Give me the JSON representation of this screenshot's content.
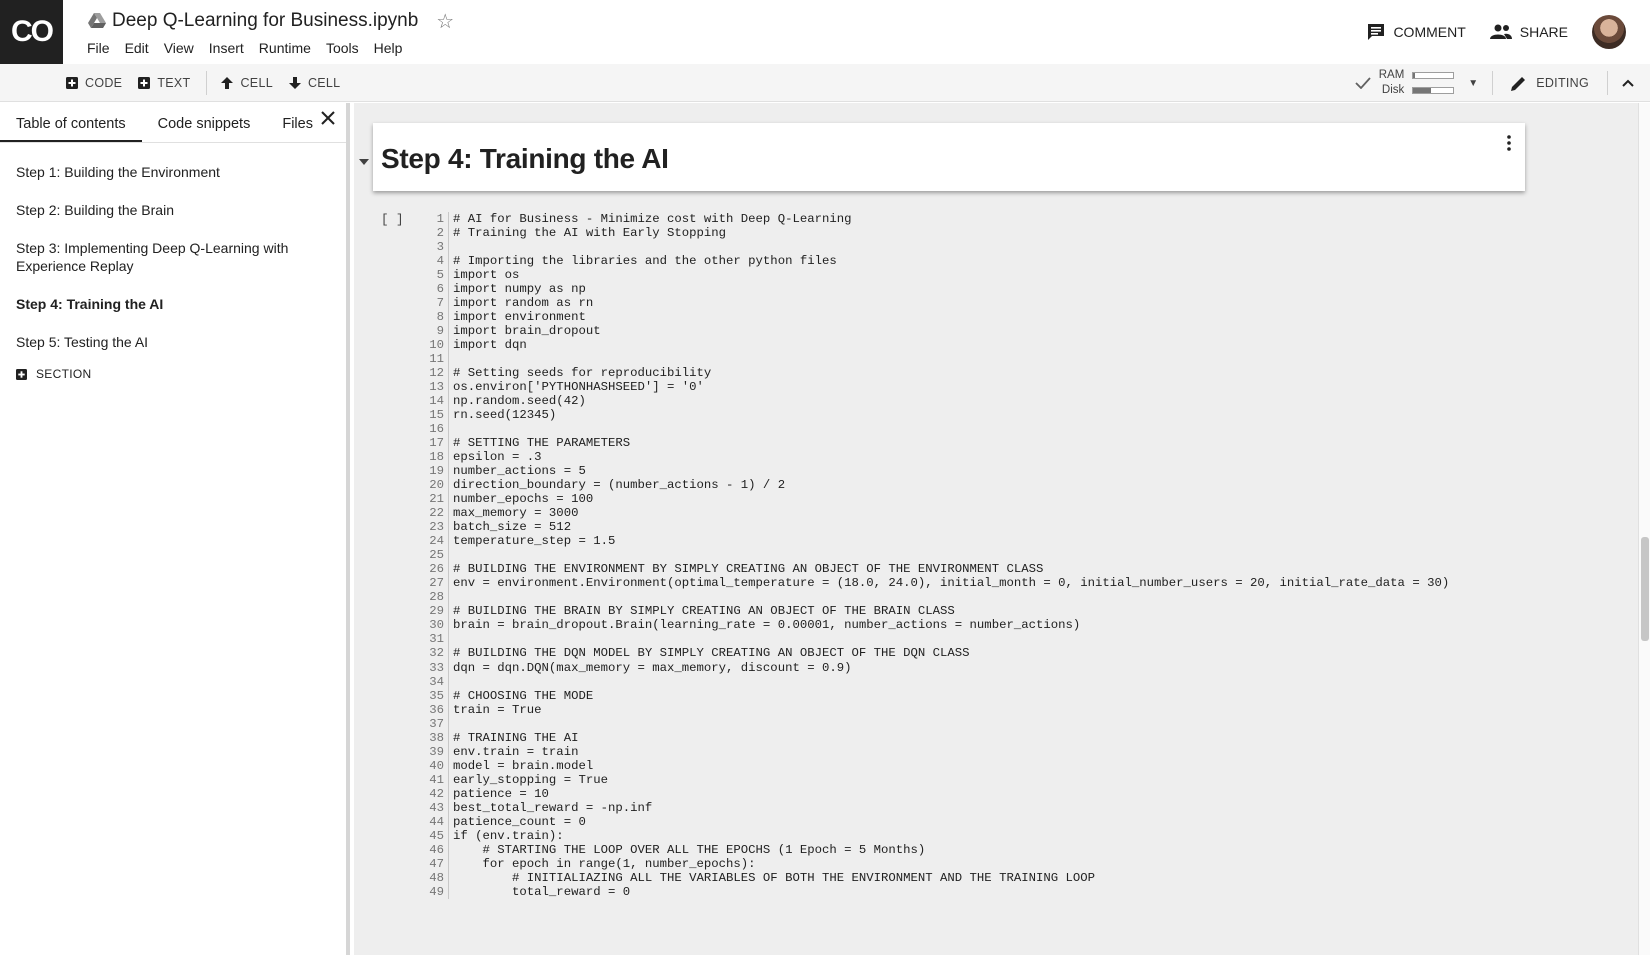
{
  "app": {
    "logo": "CO",
    "doc_title": "Deep Q-Learning for Business.ipynb"
  },
  "menu": [
    "File",
    "Edit",
    "View",
    "Insert",
    "Runtime",
    "Tools",
    "Help"
  ],
  "header_actions": {
    "comment": "COMMENT",
    "share": "SHARE"
  },
  "toolbar": {
    "add_code": "CODE",
    "add_text": "TEXT",
    "cell_up": "CELL",
    "cell_down": "CELL",
    "ram_label": "RAM",
    "disk_label": "Disk",
    "ram_fraction": 0.05,
    "disk_fraction": 0.45,
    "editing": "EDITING"
  },
  "sidebar": {
    "tabs": [
      "Table of contents",
      "Code snippets",
      "Files"
    ],
    "active_tab": "Table of contents",
    "toc": [
      {
        "label": "Step 1: Building the Environment",
        "bold": false
      },
      {
        "label": "Step 2: Building the Brain",
        "bold": false
      },
      {
        "label": "Step 3: Implementing Deep Q-Learning with Experience Replay",
        "bold": false
      },
      {
        "label": "Step 4: Training the AI",
        "bold": true
      },
      {
        "label": "Step 5: Testing the AI",
        "bold": false
      }
    ],
    "add_section": "SECTION"
  },
  "notebook": {
    "heading": "Step 4: Training the AI",
    "run_indicator": "[ ]",
    "code_lines": [
      "# AI for Business - Minimize cost with Deep Q-Learning",
      "# Training the AI with Early Stopping",
      "",
      "# Importing the libraries and the other python files",
      "import os",
      "import numpy as np",
      "import random as rn",
      "import environment",
      "import brain_dropout",
      "import dqn",
      "",
      "# Setting seeds for reproducibility",
      "os.environ['PYTHONHASHSEED'] = '0'",
      "np.random.seed(42)",
      "rn.seed(12345)",
      "",
      "# SETTING THE PARAMETERS",
      "epsilon = .3",
      "number_actions = 5",
      "direction_boundary = (number_actions - 1) / 2",
      "number_epochs = 100",
      "max_memory = 3000",
      "batch_size = 512",
      "temperature_step = 1.5",
      "",
      "# BUILDING THE ENVIRONMENT BY SIMPLY CREATING AN OBJECT OF THE ENVIRONMENT CLASS",
      "env = environment.Environment(optimal_temperature = (18.0, 24.0), initial_month = 0, initial_number_users = 20, initial_rate_data = 30)",
      "",
      "# BUILDING THE BRAIN BY SIMPLY CREATING AN OBJECT OF THE BRAIN CLASS",
      "brain = brain_dropout.Brain(learning_rate = 0.00001, number_actions = number_actions)",
      "",
      "# BUILDING THE DQN MODEL BY SIMPLY CREATING AN OBJECT OF THE DQN CLASS",
      "dqn = dqn.DQN(max_memory = max_memory, discount = 0.9)",
      "",
      "# CHOOSING THE MODE",
      "train = True",
      "",
      "# TRAINING THE AI",
      "env.train = train",
      "model = brain.model",
      "early_stopping = True",
      "patience = 10",
      "best_total_reward = -np.inf",
      "patience_count = 0",
      "if (env.train):",
      "    # STARTING THE LOOP OVER ALL THE EPOCHS (1 Epoch = 5 Months)",
      "    for epoch in range(1, number_epochs):",
      "        # INITIALIAZING ALL THE VARIABLES OF BOTH THE ENVIRONMENT AND THE TRAINING LOOP",
      "        total_reward = 0"
    ],
    "scroll_fraction": 0.58
  },
  "colors": {
    "logo_bg": "#212121",
    "sidebar_divider": "#d6d6d6",
    "notebook_bg": "#eeeeee"
  }
}
